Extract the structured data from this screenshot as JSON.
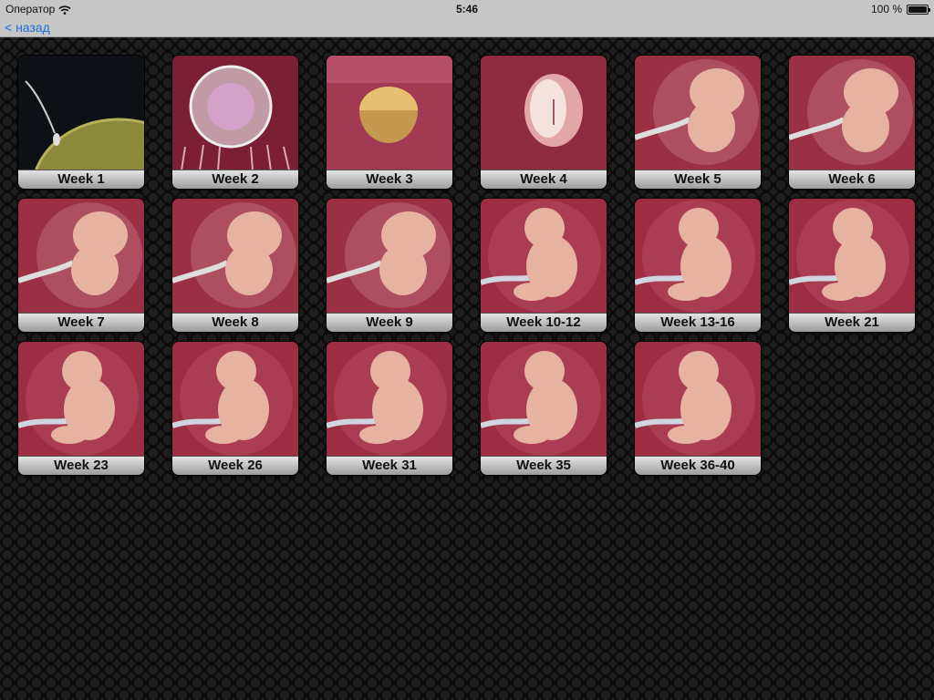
{
  "status_bar": {
    "carrier": "Оператор",
    "time": "5:46",
    "battery": "100 %"
  },
  "nav": {
    "back_label": "< назад"
  },
  "weeks": [
    {
      "label": "Week 1"
    },
    {
      "label": "Week 2"
    },
    {
      "label": "Week 3"
    },
    {
      "label": "Week 4"
    },
    {
      "label": "Week 5"
    },
    {
      "label": "Week 6"
    },
    {
      "label": "Week 7"
    },
    {
      "label": "Week 8"
    },
    {
      "label": "Week 9"
    },
    {
      "label": "Week 10-12"
    },
    {
      "label": "Week 13-16"
    },
    {
      "label": "Week 21"
    },
    {
      "label": "Week 23"
    },
    {
      "label": "Week 26"
    },
    {
      "label": "Week 31"
    },
    {
      "label": "Week 35"
    },
    {
      "label": "Week 36-40"
    }
  ],
  "colors": {
    "accent": "#1a6fd6",
    "tile_bg": "#8e2436",
    "embryo": "#e6b3a3"
  }
}
